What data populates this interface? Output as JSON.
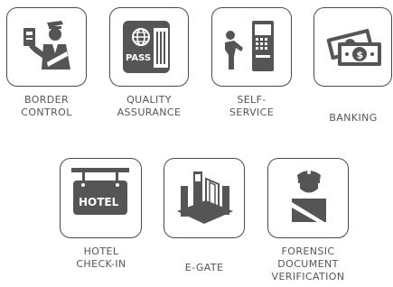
{
  "colors": {
    "icon": "#555555",
    "border": "#4a4a4a",
    "text": "#555555",
    "background": "#ffffff"
  },
  "items": [
    {
      "icon": "border-officer-icon",
      "lines": [
        "BORDER",
        "CONTROL"
      ]
    },
    {
      "icon": "passport-icon",
      "badge": "PASS",
      "lines": [
        "QUALITY",
        "ASSURANCE"
      ]
    },
    {
      "icon": "self-service-kiosk-icon",
      "lines": [
        "SELF-",
        "SERVICE"
      ]
    },
    {
      "icon": "money-icon",
      "lines": [
        "BANKING"
      ]
    },
    {
      "icon": "hotel-sign-icon",
      "badge": "HOTEL",
      "lines": [
        "HOTEL",
        "CHECK-IN"
      ]
    },
    {
      "icon": "e-gate-icon",
      "lines": [
        "E-GATE"
      ]
    },
    {
      "icon": "officer-icon",
      "lines": [
        "FORENSIC",
        "DOCUMENT",
        "VERIFICATION"
      ]
    }
  ]
}
